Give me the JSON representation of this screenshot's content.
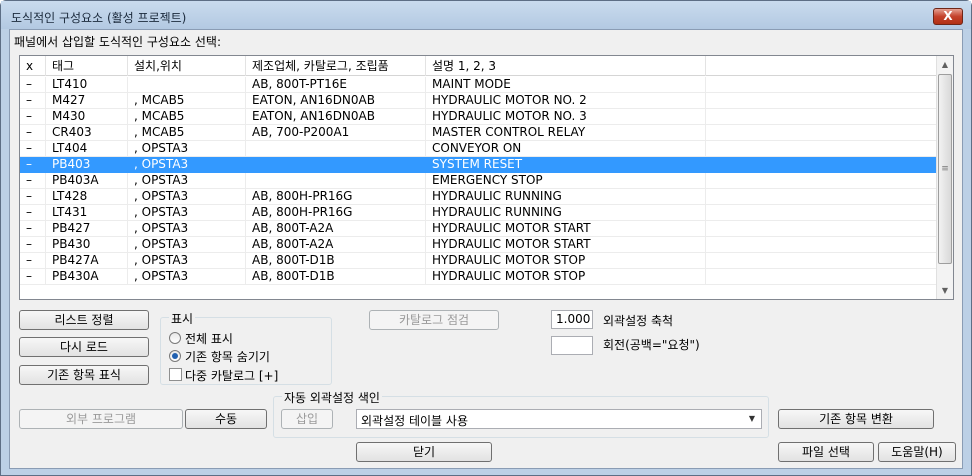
{
  "window": {
    "title": "도식적인 구성요소 (활성 프로젝트)",
    "close_label": "X"
  },
  "instruction": "패널에서 삽입할 도식적인 구성요소 선택:",
  "table": {
    "headers": [
      "x",
      "태그",
      "설치,위치",
      "제조업체, 카탈로그, 조립품",
      "설명 1, 2, 3"
    ],
    "rows": [
      {
        "x": "–",
        "tag": "LT410",
        "location": "",
        "catalog": "AB, 800T-PT16E",
        "description": "MAINT MODE"
      },
      {
        "x": "–",
        "tag": "M427",
        "location": ", MCAB5",
        "catalog": "EATON, AN16DN0AB",
        "description": "HYDRAULIC MOTOR NO. 2"
      },
      {
        "x": "–",
        "tag": "M430",
        "location": ", MCAB5",
        "catalog": "EATON, AN16DN0AB",
        "description": "HYDRAULIC MOTOR NO. 3"
      },
      {
        "x": "–",
        "tag": "CR403",
        "location": ", MCAB5",
        "catalog": "AB, 700-P200A1",
        "description": "MASTER CONTROL RELAY"
      },
      {
        "x": "–",
        "tag": "LT404",
        "location": ", OPSTA3",
        "catalog": "",
        "description": "CONVEYOR ON"
      },
      {
        "x": "–",
        "tag": "PB403",
        "location": ", OPSTA3",
        "catalog": "",
        "description": "SYSTEM RESET",
        "selected": true
      },
      {
        "x": "–",
        "tag": "PB403A",
        "location": ", OPSTA3",
        "catalog": "",
        "description": "EMERGENCY STOP"
      },
      {
        "x": "–",
        "tag": "LT428",
        "location": ", OPSTA3",
        "catalog": "AB, 800H-PR16G",
        "description": "HYDRAULIC RUNNING"
      },
      {
        "x": "–",
        "tag": "LT431",
        "location": ", OPSTA3",
        "catalog": "AB, 800H-PR16G",
        "description": "HYDRAULIC RUNNING"
      },
      {
        "x": "–",
        "tag": "PB427",
        "location": ", OPSTA3",
        "catalog": "AB, 800T-A2A",
        "description": "HYDRAULIC MOTOR START"
      },
      {
        "x": "–",
        "tag": "PB430",
        "location": ", OPSTA3",
        "catalog": "AB, 800T-A2A",
        "description": "HYDRAULIC MOTOR START"
      },
      {
        "x": "–",
        "tag": "PB427A",
        "location": ", OPSTA3",
        "catalog": "AB, 800T-D1B",
        "description": "HYDRAULIC MOTOR STOP"
      },
      {
        "x": "–",
        "tag": "PB430A",
        "location": ", OPSTA3",
        "catalog": "AB, 800T-D1B",
        "description": "HYDRAULIC MOTOR STOP"
      }
    ]
  },
  "buttons": {
    "sort_list": "리스트 정렬",
    "reload": "다시 로드",
    "mark_existing": "기존 항목 표식",
    "catalog_check": "카탈로그 점검",
    "external_program": "외부 프로그램",
    "manual": "수동",
    "insert": "삽입",
    "swap_existing": "기존 항목 변환",
    "close": "닫기",
    "pick_file": "파일 선택",
    "help": "도움말(H)"
  },
  "display_group": {
    "title": "표시",
    "show_all": "전체 표시",
    "hide_existing": "기존 항목 숨기기",
    "multi_catalog": "다중 카탈로그 [+]",
    "selected_option": "hide_existing"
  },
  "scale": {
    "value": "1.000",
    "label": "외곽설정 축척"
  },
  "rotation": {
    "value": "",
    "label": "회전(공백=\"요청\")"
  },
  "auto_footprint": {
    "title": "자동 외곽설정 색인",
    "selected": "외곽설정 테이블 사용"
  },
  "icons": {
    "close": "close-icon",
    "scroll_up": "scroll-up-arrow-icon",
    "scroll_down": "scroll-down-arrow-icon",
    "dropdown": "chevron-down-icon",
    "grip": "scroll-grip-icon"
  },
  "colors": {
    "selection": "#3399ff",
    "titlebar": "#bcd0e6",
    "close_button": "#c4412b"
  }
}
